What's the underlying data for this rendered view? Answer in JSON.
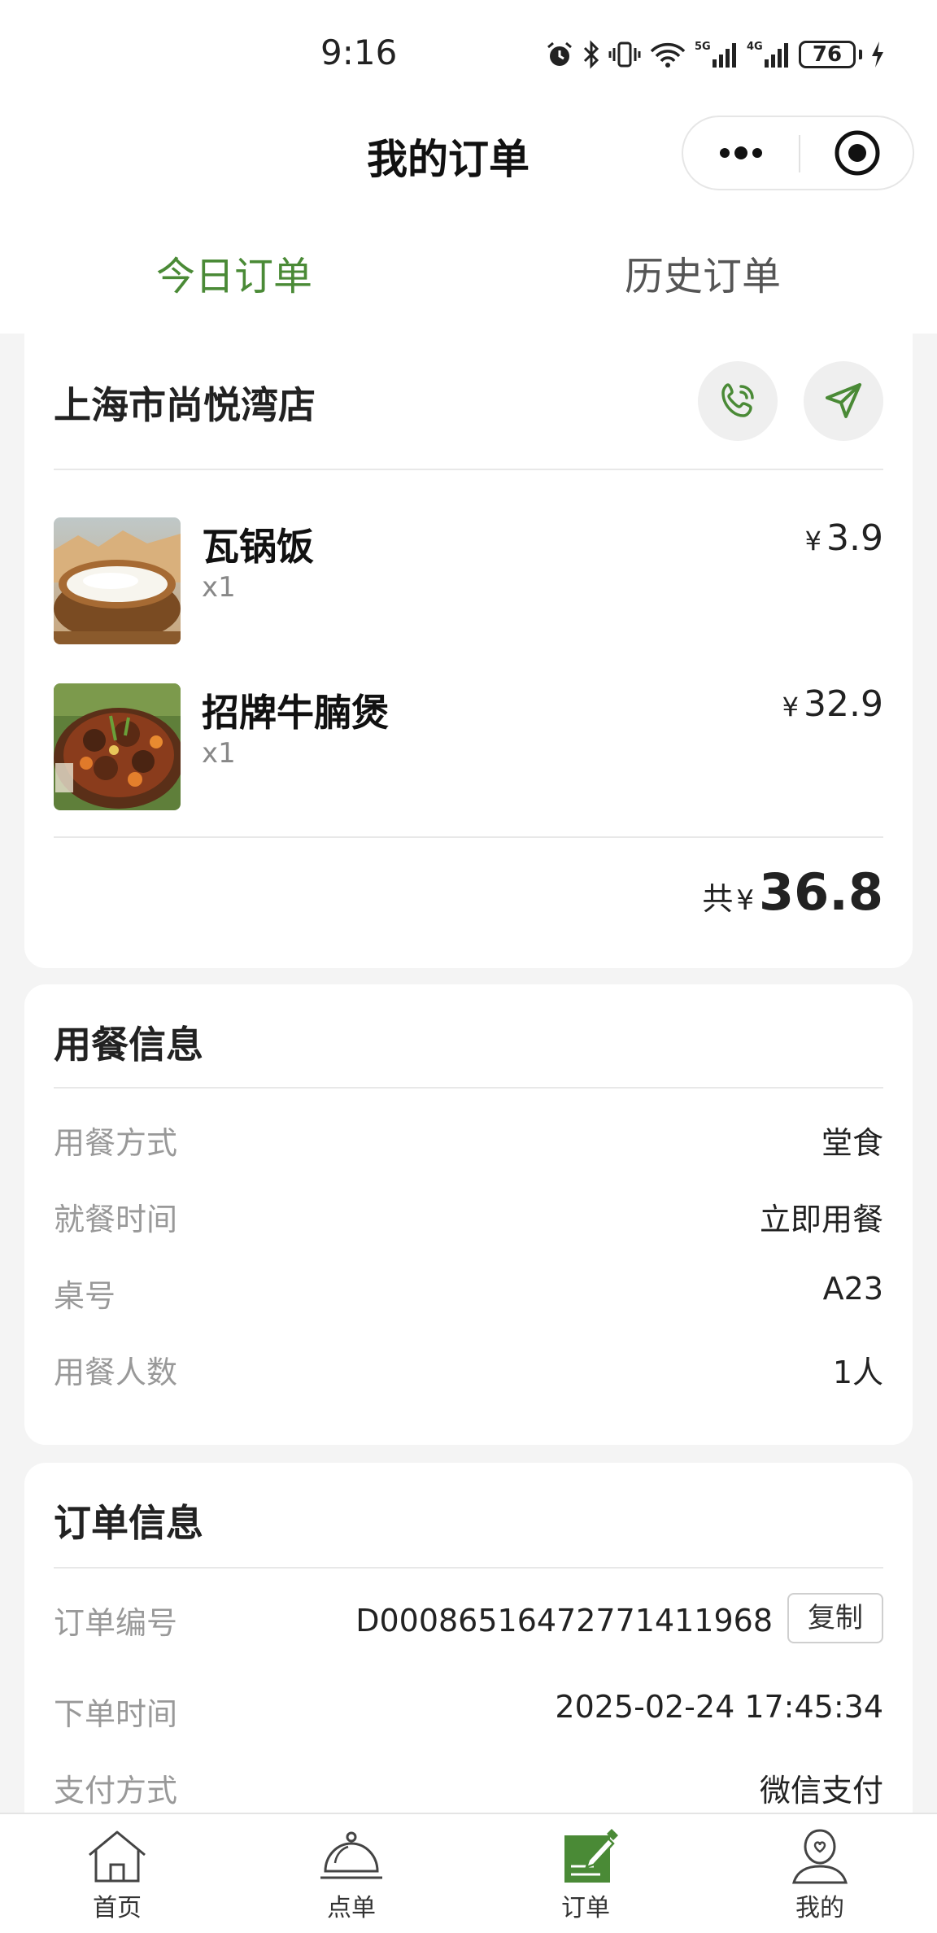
{
  "status_bar": {
    "time": "9:16",
    "battery_level": "76",
    "icons": [
      "alarm-icon",
      "bluetooth-icon",
      "vibrate-icon",
      "wifi-icon",
      "signal-5g-icon",
      "signal-4g-icon",
      "battery-icon",
      "charging-icon"
    ]
  },
  "header": {
    "title": "我的订单",
    "capsule_icons": [
      "more-icon",
      "target-icon"
    ]
  },
  "tabs": [
    {
      "label": "今日订单",
      "active": true
    },
    {
      "label": "历史订单",
      "active": false
    }
  ],
  "store": {
    "name": "上海市尚悦湾店",
    "icons": [
      "phone-icon",
      "navigation-icon"
    ]
  },
  "items": [
    {
      "name": "瓦锅饭",
      "qty": "x1",
      "currency": "¥",
      "price": "3.9"
    },
    {
      "name": "招牌牛腩煲",
      "qty": "x1",
      "currency": "¥",
      "price": "32.9"
    }
  ],
  "total": {
    "label": "共",
    "currency": "¥",
    "value": "36.8"
  },
  "dining_info": {
    "title": "用餐信息",
    "rows": [
      {
        "label": "用餐方式",
        "value": "堂食"
      },
      {
        "label": "就餐时间",
        "value": "立即用餐"
      },
      {
        "label": "桌号",
        "value": "A23"
      },
      {
        "label": "用餐人数",
        "value": "1人"
      }
    ]
  },
  "order_info": {
    "title": "订单信息",
    "rows": [
      {
        "label": "订单编号",
        "value": "D00086516472771411968"
      },
      {
        "label": "下单时间",
        "value": "2025-02-24 17:45:34"
      },
      {
        "label": "支付方式",
        "value": "微信支付"
      }
    ],
    "copy_label": "复制"
  },
  "tabbar": [
    {
      "label": "首页",
      "icon": "home-icon"
    },
    {
      "label": "点单",
      "icon": "cloche-icon"
    },
    {
      "label": "订单",
      "icon": "order-icon",
      "active": true
    },
    {
      "label": "我的",
      "icon": "profile-icon"
    }
  ],
  "colors": {
    "accent": "#4a8a36",
    "background": "#f4f4f4"
  }
}
